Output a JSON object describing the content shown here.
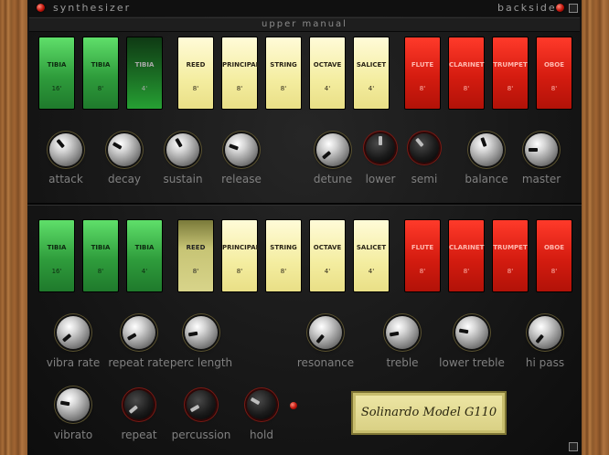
{
  "header": {
    "title": "synthesizer",
    "backside_label": "backside",
    "manual_label": "upper manual"
  },
  "upper_tabs": [
    {
      "name": "TIBIA",
      "feet": "16'",
      "color": "green",
      "down": false
    },
    {
      "name": "TIBIA",
      "feet": "8'",
      "color": "green",
      "down": false
    },
    {
      "name": "TIBIA",
      "feet": "4'",
      "color": "green",
      "down": true
    },
    {
      "name": "REED",
      "feet": "8'",
      "color": "cream",
      "down": false
    },
    {
      "name": "PRINCIPAL",
      "feet": "8'",
      "color": "cream",
      "down": false
    },
    {
      "name": "STRING",
      "feet": "8'",
      "color": "cream",
      "down": false
    },
    {
      "name": "OCTAVE",
      "feet": "4'",
      "color": "cream",
      "down": false
    },
    {
      "name": "SALICET",
      "feet": "4'",
      "color": "cream",
      "down": false
    },
    {
      "name": "FLUTE",
      "feet": "8'",
      "color": "red",
      "down": false
    },
    {
      "name": "CLARINET",
      "feet": "8'",
      "color": "red",
      "down": false
    },
    {
      "name": "TRUMPET",
      "feet": "8'",
      "color": "red",
      "down": false
    },
    {
      "name": "OBOE",
      "feet": "8'",
      "color": "red",
      "down": false
    }
  ],
  "lower_tabs": [
    {
      "name": "TIBIA",
      "feet": "16'",
      "color": "green",
      "down": false
    },
    {
      "name": "TIBIA",
      "feet": "8'",
      "color": "green",
      "down": false
    },
    {
      "name": "TIBIA",
      "feet": "4'",
      "color": "green",
      "down": false
    },
    {
      "name": "REED",
      "feet": "8'",
      "color": "cream",
      "down": true
    },
    {
      "name": "PRINCIPAL",
      "feet": "8'",
      "color": "cream",
      "down": false
    },
    {
      "name": "STRING",
      "feet": "8'",
      "color": "cream",
      "down": false
    },
    {
      "name": "OCTAVE",
      "feet": "4'",
      "color": "cream",
      "down": false
    },
    {
      "name": "SALICET",
      "feet": "4'",
      "color": "cream",
      "down": false
    },
    {
      "name": "FLUTE",
      "feet": "8'",
      "color": "red",
      "down": false
    },
    {
      "name": "CLARINET",
      "feet": "8'",
      "color": "red",
      "down": false
    },
    {
      "name": "TRUMPET",
      "feet": "8'",
      "color": "red",
      "down": false
    },
    {
      "name": "OBOE",
      "feet": "8'",
      "color": "red",
      "down": false
    }
  ],
  "upper_knobs": [
    {
      "label": "attack"
    },
    {
      "label": "decay"
    },
    {
      "label": "sustain"
    },
    {
      "label": "release"
    },
    {
      "label": "detune"
    },
    {
      "label": "lower"
    },
    {
      "label": "semi"
    },
    {
      "label": "balance"
    },
    {
      "label": "master"
    }
  ],
  "lower_knobs": [
    {
      "label": "vibra rate"
    },
    {
      "label": "repeat rate"
    },
    {
      "label": "perc length"
    },
    {
      "label": "resonance"
    },
    {
      "label": "treble"
    },
    {
      "label": "lower treble"
    },
    {
      "label": "hi pass"
    }
  ],
  "bottom_knobs": [
    {
      "label": "vibrato"
    },
    {
      "label": "repeat"
    },
    {
      "label": "percussion"
    },
    {
      "label": "hold"
    }
  ],
  "model_plate": "Solinardo Model G110",
  "colors": {
    "tab_green": "#3fb24b",
    "tab_cream": "#f4eda0",
    "tab_red": "#d51c10",
    "led_red": "#c1140a",
    "plate": "#e2d98f"
  }
}
